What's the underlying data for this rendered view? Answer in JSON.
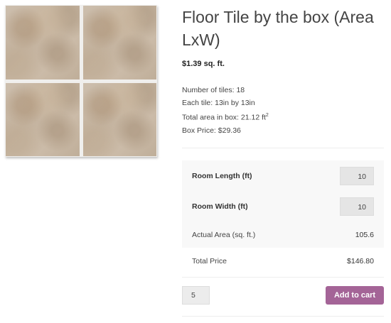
{
  "product": {
    "image_alt": "floor-tile-photo",
    "title": "Floor Tile by the box (Area LxW)",
    "price": "$1.39 sq. ft."
  },
  "details": {
    "tiles": "Number of tiles: 18",
    "each_tile": "Each tile: 13in by 13in",
    "area_prefix": "Total area in box: 21.12 ft",
    "area_sup": "2",
    "box_price": "Box Price: $29.36"
  },
  "calculator": {
    "length_label": "Room Length (ft)",
    "length_value": "10",
    "width_label": "Room Width (ft)",
    "width_value": "10",
    "area_label": "Actual Area (sq. ft.)",
    "area_value": "105.6",
    "total_label": "Total Price",
    "total_value": "$146.80"
  },
  "cart": {
    "quantity": "5",
    "button_label": "Add to cart",
    "button_color": "#a46497"
  }
}
